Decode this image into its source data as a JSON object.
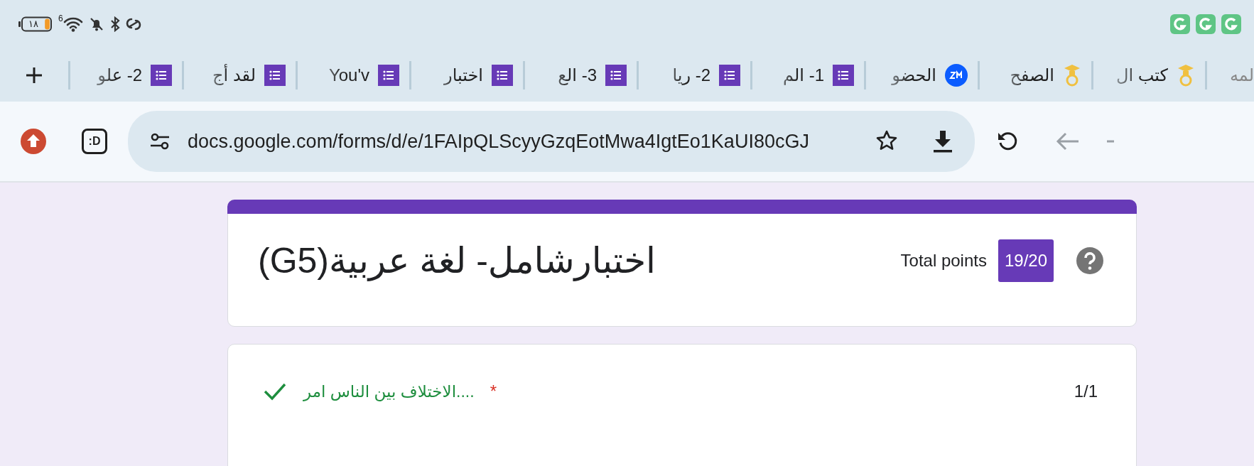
{
  "status_bar": {
    "battery": {
      "text": "١٨",
      "level": 0.18
    },
    "wifi_badge": "6"
  },
  "tabs": [
    {
      "label": "لمه",
      "kind": "cut",
      "selected": false
    },
    {
      "label": "كتب ال",
      "kind": "cap",
      "selected": false
    },
    {
      "label": "الصفح",
      "kind": "cap",
      "selected": false
    },
    {
      "label": "الحضو",
      "kind": "video",
      "selected": false
    },
    {
      "label": "1- الم",
      "kind": "form",
      "selected": false
    },
    {
      "label": "2- ريا",
      "kind": "form",
      "selected": false
    },
    {
      "label": "3- الع",
      "kind": "form",
      "selected": false
    },
    {
      "label": "اختبار",
      "kind": "form",
      "selected": false
    },
    {
      "label": "You'v",
      "kind": "form",
      "selected": false
    },
    {
      "label": "لقد أج",
      "kind": "form",
      "selected": false
    },
    {
      "label": "2- علو",
      "kind": "form",
      "selected": false
    }
  ],
  "toolbar": {
    "profile_text": ":D",
    "url": "docs.google.com/forms/d/e/1FAIpQLScyyGzqEotMwa4IgtEo1KaUI80cGJ",
    "back_disabled": true
  },
  "form": {
    "title": "اختبارشامل- لغة عربية(G5)",
    "total_label": "Total points",
    "total": "19/20"
  },
  "questions": [
    {
      "text": "....الاختلاف بين الناس امر",
      "asterisk": "*",
      "correct": true,
      "score": "1/1"
    }
  ]
}
